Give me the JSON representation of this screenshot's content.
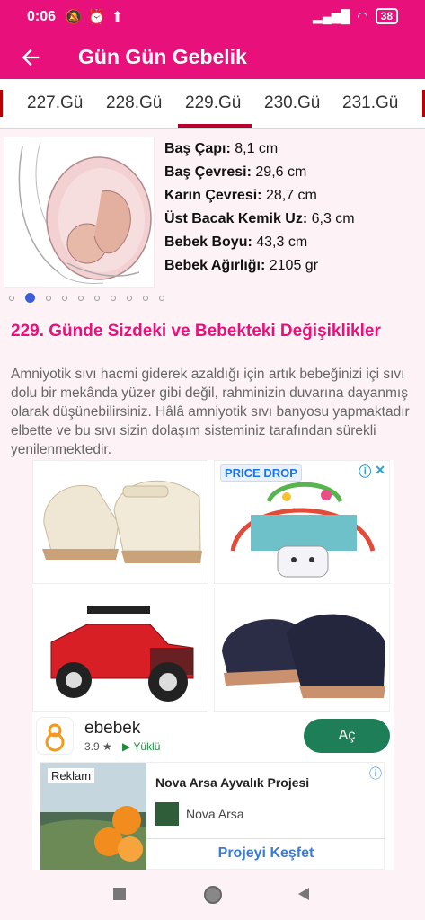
{
  "status_bar": {
    "time": "0:06",
    "battery": "38"
  },
  "app_bar": {
    "title": "Gün Gün Gebelik"
  },
  "tabs": [
    "227.Gü",
    "228.Gü",
    "229.Gü",
    "230.Gü",
    "231.Gü"
  ],
  "active_tab": "229.Gü",
  "measurements": [
    {
      "label": "Baş Çapı:",
      "value": " 8,1 cm"
    },
    {
      "label": "Baş Çevresi:",
      "value": " 29,6 cm"
    },
    {
      "label": "Karın Çevresi:",
      "value": " 28,7 cm"
    },
    {
      "label": "Üst Bacak Kemik Uz:",
      "value": " 6,3 cm"
    },
    {
      "label": "Bebek Boyu:",
      "value": " 43,3 cm"
    },
    {
      "label": "Bebek Ağırlığı:",
      "value": " 2105 gr"
    }
  ],
  "carousel": {
    "count": 10,
    "active_index": 1
  },
  "section": {
    "heading": "229. Günde Sizdeki ve Bebekteki Değişiklikler",
    "body": "Amniyotik sıvı hacmi giderek azaldığı için artık bebeğinizi içi sıvı dolu bir mekânda yüzer gibi değil, rahminizin duvarına dayanmış olarak düşünebilirsiniz. Hâlâ amniyotik sıvı banyosu yapmaktadır elbette ve bu sıvı sizin dolaşım sisteminiz tarafından sürekli yenilenmektedir."
  },
  "ad": {
    "price_drop": "PRICE DROP",
    "advertiser": {
      "name": "ebebek",
      "rating": "3.9 ★",
      "installed": "Yüklü",
      "button": "Aç"
    },
    "card": {
      "badge": "Reklam",
      "title": "Nova Arsa Ayvalık Projesi",
      "sponsor": "Nova Arsa",
      "cta": "Projeyi Keşfet"
    }
  },
  "colors": {
    "brand": "#e8117b",
    "active_dot": "#3b5fd9",
    "open_button": "#1e7e57"
  }
}
